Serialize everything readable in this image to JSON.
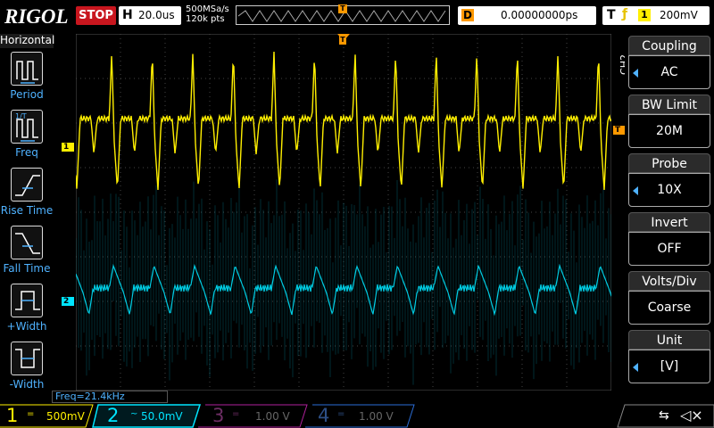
{
  "brand": "RIGOL",
  "run_state": "STOP",
  "horizontal": {
    "letter": "H",
    "timebase": "20.0us",
    "sample_rate": "500MSa/s",
    "points": "120k pts"
  },
  "trigger_pos_marker": "T",
  "delay": {
    "letter": "D",
    "value": "0.00000000ps"
  },
  "trigger": {
    "letter": "T",
    "source": "1",
    "level": "200mV"
  },
  "left_menu": {
    "title": "Horizontal",
    "items": [
      {
        "label": "Period",
        "icon": "period-icon"
      },
      {
        "label": "Freq",
        "icon": "freq-icon"
      },
      {
        "label": "Rise Time",
        "icon": "rise-time-icon"
      },
      {
        "label": "Fall Time",
        "icon": "fall-time-icon"
      },
      {
        "label": "+Width",
        "icon": "pos-width-icon"
      },
      {
        "label": "-Width",
        "icon": "neg-width-icon"
      }
    ]
  },
  "right_menu": {
    "channel_label": "CH2",
    "items": [
      {
        "title": "Coupling",
        "value": "AC",
        "has_arrow": true
      },
      {
        "title": "BW Limit",
        "value": "20M",
        "has_arrow": false
      },
      {
        "title": "Probe",
        "value": "10X",
        "has_arrow": true
      },
      {
        "title": "Invert",
        "value": "OFF",
        "has_arrow": false
      },
      {
        "title": "Volts/Div",
        "value": "Coarse",
        "has_arrow": false
      },
      {
        "title": "Unit",
        "value": "[V]",
        "has_arrow": true
      }
    ]
  },
  "measurement": "Freq=21.4kHz",
  "channels": [
    {
      "num": "1",
      "coupling": "=",
      "scale": "500mV",
      "color": "#ffef00",
      "active": false
    },
    {
      "num": "2",
      "coupling": "~",
      "scale": "50.0mV",
      "color": "#00e5ff",
      "active": true
    },
    {
      "num": "3",
      "coupling": "=",
      "scale": "1.00 V",
      "color": "#b0209b",
      "active": false
    },
    {
      "num": "4",
      "coupling": "=",
      "scale": "1.00 V",
      "color": "#2a6cd6",
      "active": false
    }
  ],
  "markers": {
    "ch1": "1",
    "ch2": "2",
    "trig_level": "T"
  },
  "colors": {
    "ch1": "#ffef00",
    "ch2": "#00e5ff",
    "accent": "#4fb2ff",
    "stop": "#c8161e",
    "trigger": "#ff9900"
  }
}
